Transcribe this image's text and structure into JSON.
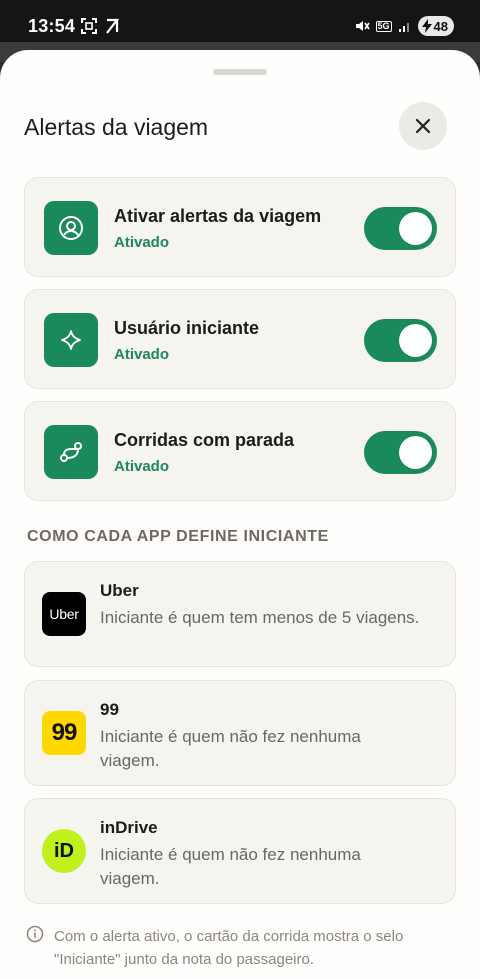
{
  "status_bar": {
    "time": "13:54",
    "network": "5G",
    "battery": "48"
  },
  "sheet": {
    "title": "Alertas da viagem"
  },
  "toggles": [
    {
      "title": "Ativar alertas da viagem",
      "status": "Ativado",
      "icon": "user-circle-icon",
      "enabled": true
    },
    {
      "title": "Usuário iniciante",
      "status": "Ativado",
      "icon": "sparkle-icon",
      "enabled": true
    },
    {
      "title": "Corridas com parada",
      "status": "Ativado",
      "icon": "route-icon",
      "enabled": true
    }
  ],
  "section": {
    "label": "COMO CADA APP DEFINE INICIANTE"
  },
  "apps": [
    {
      "name": "Uber",
      "logo_text": "Uber",
      "description": "Iniciante é quem tem menos de 5 viagens."
    },
    {
      "name": "99",
      "logo_text": "99",
      "description": "Iniciante é quem não fez nenhuma viagem."
    },
    {
      "name": "inDrive",
      "logo_text": "iD",
      "description": "Iniciante é quem não fez nenhuma viagem."
    }
  ],
  "footer": {
    "note": "Com o alerta ativo, o cartão da corrida mostra o selo \"Iniciante\" junto da nota do passageiro."
  },
  "colors": {
    "accent_green": "#1a8a5a",
    "uber_black": "#000000",
    "ninety_nine_yellow": "#ffd800",
    "indrive_lime": "#c1f11d"
  }
}
